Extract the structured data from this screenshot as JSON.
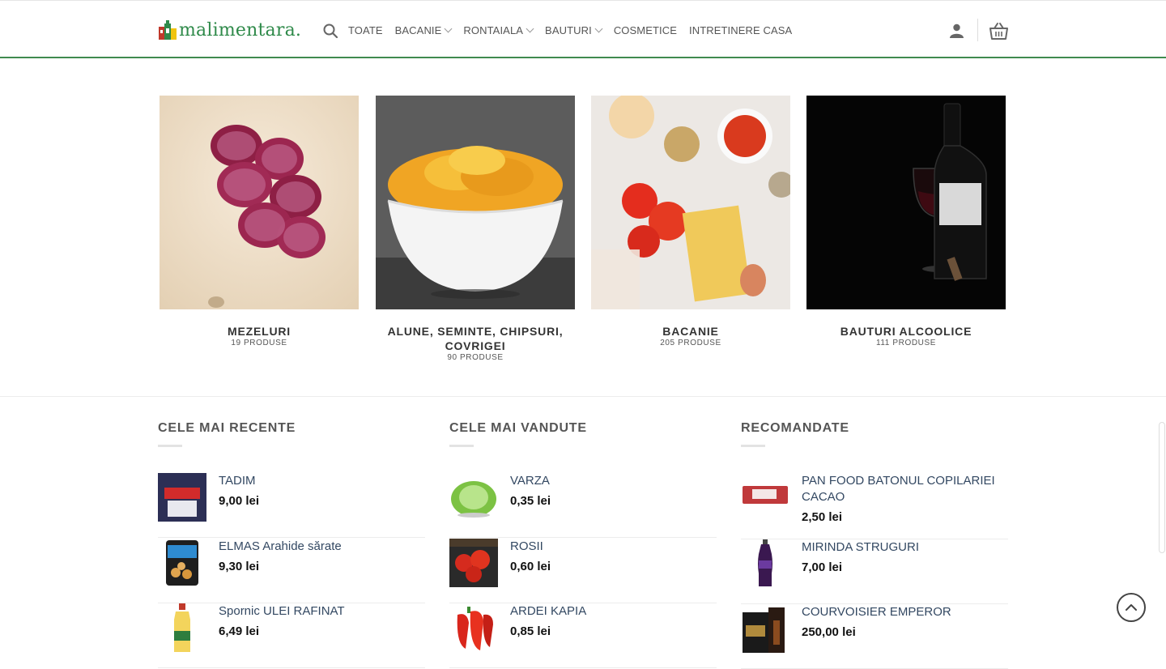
{
  "header": {
    "logo_text": "malimentara",
    "logo_dot": ".",
    "nav": [
      {
        "label": "TOATE",
        "dropdown": false
      },
      {
        "label": "BACANIE",
        "dropdown": true
      },
      {
        "label": "RONTAIALA",
        "dropdown": true
      },
      {
        "label": "BAUTURI",
        "dropdown": true
      },
      {
        "label": "COSMETICE",
        "dropdown": false
      },
      {
        "label": "INTRETINERE CASA",
        "dropdown": false
      }
    ],
    "accent_color": "#3f8a4f"
  },
  "categories": [
    {
      "title": "MEZELURI",
      "count": "19 PRODUSE"
    },
    {
      "title": "ALUNE, SEMINTE, CHIPSURI, COVRIGEI",
      "count": "90 PRODUSE"
    },
    {
      "title": "BACANIE",
      "count": "205 PRODUSE"
    },
    {
      "title": "BAUTURI ALCOOLICE",
      "count": "111 PRODUSE"
    }
  ],
  "widgets": [
    {
      "title": "CELE MAI RECENTE",
      "products": [
        {
          "name": "TADIM",
          "price": "9,00",
          "currency": "lei"
        },
        {
          "name": "ELMAS Arahide sărate",
          "price": "9,30",
          "currency": "lei"
        },
        {
          "name": "Spornic ULEI RAFINAT",
          "price": "6,49",
          "currency": "lei"
        }
      ]
    },
    {
      "title": "CELE MAI VANDUTE",
      "products": [
        {
          "name": "VARZA",
          "price": "0,35",
          "currency": "lei"
        },
        {
          "name": "ROSII",
          "price": "0,60",
          "currency": "lei"
        },
        {
          "name": "ARDEI KAPIA",
          "price": "0,85",
          "currency": "lei"
        }
      ]
    },
    {
      "title": "RECOMANDATE",
      "products": [
        {
          "name": "PAN FOOD BATONUL COPILARIEI CACAO",
          "price": "2,50",
          "currency": "lei"
        },
        {
          "name": "MIRINDA STRUGURI",
          "price": "7,00",
          "currency": "lei"
        },
        {
          "name": "COURVOISIER EMPEROR",
          "price": "250,00",
          "currency": "lei"
        }
      ]
    }
  ]
}
